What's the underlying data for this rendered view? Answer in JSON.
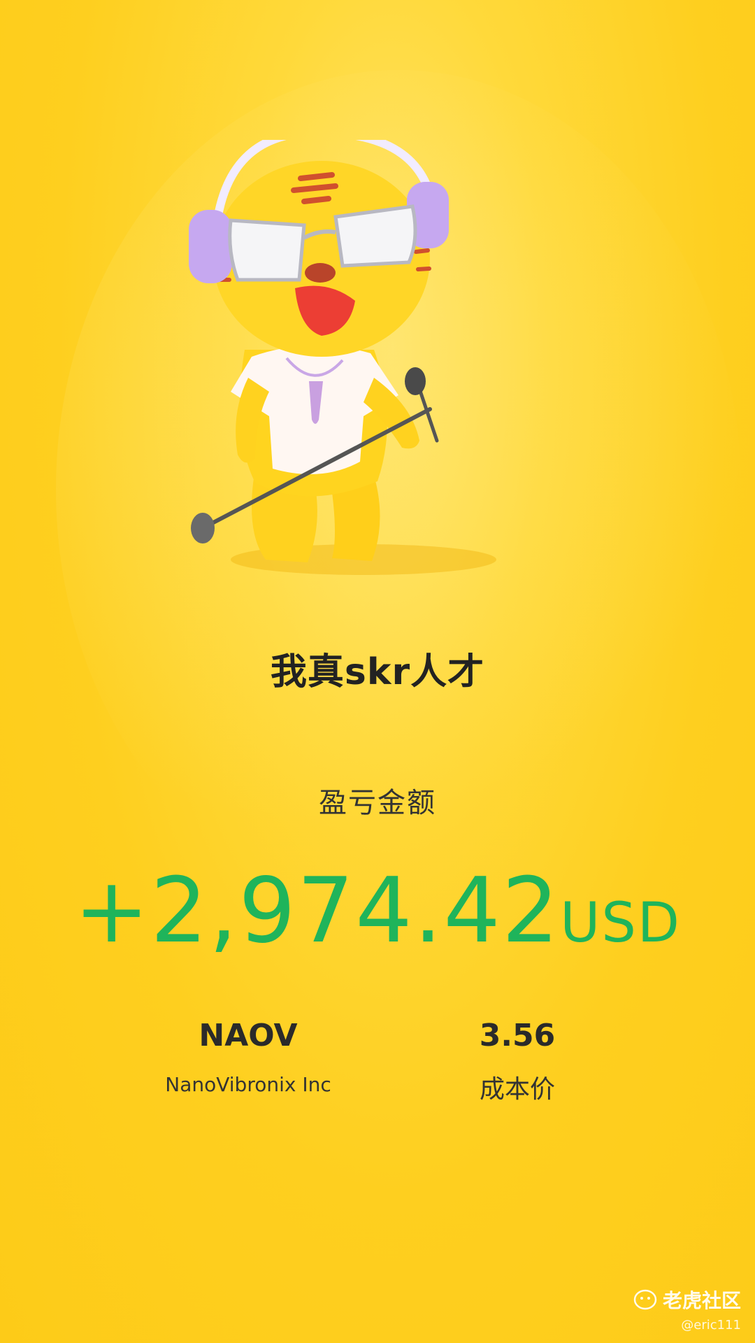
{
  "title": "我真skr人才",
  "pnl": {
    "label": "盈亏金额",
    "amount": "+2,974.42",
    "currency": "USD",
    "color": "#1fb45b"
  },
  "stock": {
    "ticker": "NAOV",
    "name": "NanoVibronix Inc",
    "cost_value": "3.56",
    "cost_label": "成本价"
  },
  "watermark": {
    "brand": "老虎社区",
    "user": "@eric111",
    "icon": "tiger-logo-icon"
  },
  "mascot": {
    "icon": "tiger-mascot-icon"
  },
  "colors": {
    "background": "#fdcb18",
    "text_dark": "#222222",
    "profit_green": "#1fb45b"
  }
}
